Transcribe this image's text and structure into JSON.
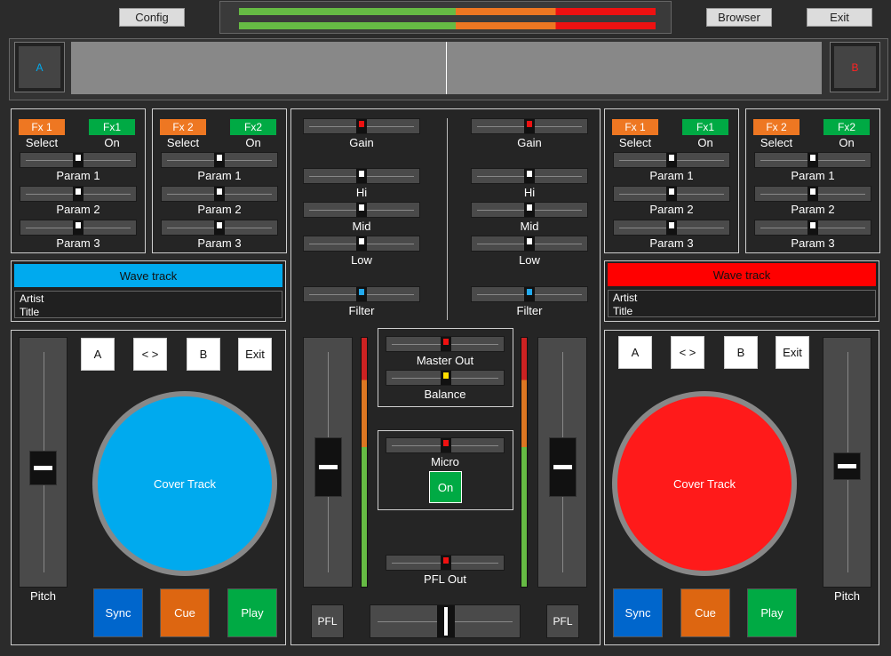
{
  "header": {
    "config_label": "Config",
    "browser_label": "Browser",
    "exit_label": "Exit"
  },
  "decks": {
    "a_label": "A",
    "b_label": "B"
  },
  "fx_left": [
    {
      "select_label": "Fx 1",
      "on_label": "Fx1",
      "select_caption": "Select",
      "on_caption": "On",
      "params": [
        "Param 1",
        "Param 2",
        "Param 3"
      ]
    },
    {
      "select_label": "Fx 2",
      "on_label": "Fx2",
      "select_caption": "Select",
      "on_caption": "On",
      "params": [
        "Param 1",
        "Param 2",
        "Param 3"
      ]
    }
  ],
  "fx_right": [
    {
      "select_label": "Fx 1",
      "on_label": "Fx1",
      "select_caption": "Select",
      "on_caption": "On",
      "params": [
        "Param 1",
        "Param 2",
        "Param 3"
      ]
    },
    {
      "select_label": "Fx 2",
      "on_label": "Fx2",
      "select_caption": "Select",
      "on_caption": "On",
      "params": [
        "Param 1",
        "Param 2",
        "Param 3"
      ]
    }
  ],
  "track_left": {
    "wave_label": "Wave track",
    "artist": "Artist",
    "title": "Title",
    "color": "#00aaee"
  },
  "track_right": {
    "wave_label": "Wave track",
    "artist": "Artist",
    "title": "Title",
    "color": "#ff0000"
  },
  "mixer": {
    "gain": "Gain",
    "hi": "Hi",
    "mid": "Mid",
    "low": "Low",
    "filter": "Filter",
    "master_out": "Master Out",
    "balance": "Balance",
    "micro": "Micro",
    "micro_on": "On",
    "pfl_out": "PFL Out",
    "pfl": "PFL"
  },
  "deck_left": {
    "btn_a": "A",
    "btn_swap": "< >",
    "btn_b": "B",
    "btn_exit": "Exit",
    "cover": "Cover Track",
    "pitch": "Pitch",
    "sync": "Sync",
    "cue": "Cue",
    "play": "Play",
    "platter_color": "#00aaee"
  },
  "deck_right": {
    "btn_a": "A",
    "btn_swap": "< >",
    "btn_b": "B",
    "btn_exit": "Exit",
    "cover": "Cover Track",
    "pitch": "Pitch",
    "sync": "Sync",
    "cue": "Cue",
    "play": "Play",
    "platter_color": "#ff1a1a"
  },
  "colors": {
    "orange": "#ee7722",
    "green": "#00aa44",
    "blue": "#0066cc",
    "cue": "#dd6611",
    "play": "#00aa44"
  }
}
